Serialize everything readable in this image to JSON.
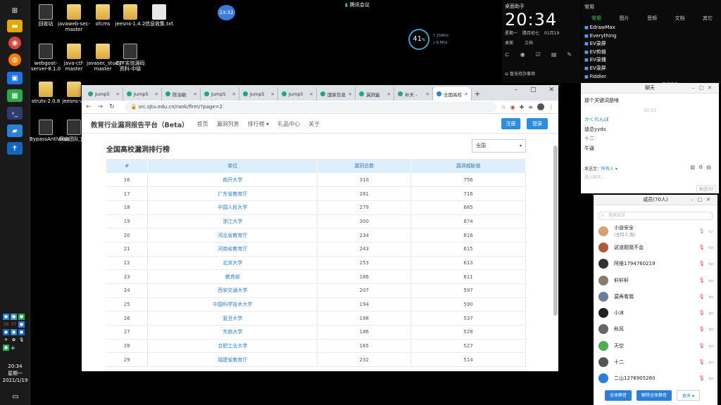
{
  "taskbar": {
    "tray_labels": [
      "39",
      "37"
    ],
    "time": "20:34",
    "weekday": "星期一",
    "date": "2021/1/19"
  },
  "desktop": {
    "icons": [
      {
        "label": "回收站",
        "kind": "app"
      },
      {
        "label": "javaweb-sec-master",
        "kind": "folder"
      },
      {
        "label": "ofcms",
        "kind": "folder"
      },
      {
        "label": "jeesns-1.4.2",
        "kind": "folder"
      },
      {
        "label": "信息收集.txt",
        "kind": "file"
      },
      {
        "label": "webgoat-server-8.1.0",
        "kind": "app"
      },
      {
        "label": "java-ctf-master",
        "kind": "folder"
      },
      {
        "label": "javasec_study-master",
        "kind": "folder"
      },
      {
        "label": "CTF实验源码资料-中级",
        "kind": "app"
      },
      {
        "label": "struts-2.0.8",
        "kind": "folder"
      },
      {
        "label": "jeesns-v1",
        "kind": "folder"
      },
      {
        "label": "BypassAntiVirus",
        "kind": "app"
      },
      {
        "label": "网安团队工具",
        "kind": "app"
      }
    ],
    "meeting_label": "腾讯会议",
    "blue_circle": "23:32",
    "speed_value": "41",
    "speed_unit": "%",
    "speed_up": "↑ 159K/s",
    "speed_down": "↓ 6.5K/s"
  },
  "clock_widget": {
    "title": "桌面助手",
    "time": "20:34",
    "weekday": "星期一",
    "lunar": "腊月初七",
    "date": "01月19",
    "row": [
      "桌面",
      "文档"
    ],
    "note": "暂无待办事项",
    "tools": [
      "⊏",
      "◉",
      "☑",
      "▤",
      "✎"
    ]
  },
  "launcher": {
    "title": "常用",
    "tabs": [
      "常用",
      "图片",
      "音频",
      "文档",
      "其它"
    ],
    "items": [
      "EdrawMax",
      "Everything",
      "EV录屏",
      "EV剪辑",
      "EV录播",
      "EV录屏",
      "Fiddler"
    ],
    "find_label": "查找文件"
  },
  "chat": {
    "title": "聊天",
    "messages": [
      {
        "type": "text",
        "text": "那个关键词是啥"
      },
      {
        "type": "time",
        "text": "20:33"
      },
      {
        "type": "nick",
        "text": "かくれんぼ"
      },
      {
        "type": "text",
        "text": "迪总yyds"
      },
      {
        "type": "nick",
        "text": "十二"
      },
      {
        "type": "text",
        "text": "牛逼"
      }
    ],
    "send_to_label": "发送至：",
    "send_to_value": "所有人 ▾",
    "placeholder": "输入聊天...",
    "send_button": "发送(S)"
  },
  "members": {
    "title": "成员(70人)",
    "search_placeholder": "搜索成员",
    "list": [
      {
        "name": "小迪安全",
        "sub": "(主持人,我)",
        "color": "#d9a070"
      },
      {
        "name": "这道题我不会",
        "sub": "",
        "color": "#b05a3a"
      },
      {
        "name": "阿维1794760219",
        "sub": "",
        "color": "#333"
      },
      {
        "name": "轩轩轩",
        "sub": "",
        "color": "#8a7b6a"
      },
      {
        "name": "莫再看我",
        "sub": "",
        "color": "#6a7fa0"
      },
      {
        "name": "小冰",
        "sub": "",
        "color": "#222"
      },
      {
        "name": "秋风",
        "sub": "",
        "color": "#666"
      },
      {
        "name": "天空",
        "sub": "",
        "color": "#4caf50"
      },
      {
        "name": "十二",
        "sub": "",
        "color": "#555"
      },
      {
        "name": "二山1276905280",
        "sub": "",
        "color": "#2b7fd8"
      }
    ],
    "footer": [
      "全体静音",
      "解除全体静音",
      "更多 ▾"
    ]
  },
  "browser": {
    "tabs": [
      "Jump5",
      "Jump5",
      "陈治敏",
      "Jump5",
      "Jump5",
      "Jump5",
      "国家信息",
      "漏洞盒",
      "补天 -",
      "全国高校"
    ],
    "url": "src.sjtu.edu.cn/rank/firm/?page=2",
    "site": {
      "brand": "教育行业漏洞报告平台（Beta）",
      "nav": [
        "首页",
        "漏洞列表",
        "排行榜 ▾",
        "礼品中心",
        "关于"
      ],
      "register": "注册",
      "login": "登录"
    },
    "page_title": "全国高校漏洞排行榜",
    "scope_select": "全国",
    "table": {
      "headers": [
        "#",
        "单位",
        "漏洞总数",
        "漏洞威胁值"
      ],
      "rows": [
        [
          "16",
          "南开大学",
          "310",
          "756"
        ],
        [
          "17",
          "广东省教育厅",
          "281",
          "716"
        ],
        [
          "18",
          "中国人民大学",
          "279",
          "685"
        ],
        [
          "19",
          "浙江大学",
          "300",
          "674"
        ],
        [
          "20",
          "河北省教育厅",
          "234",
          "616"
        ],
        [
          "21",
          "河南省教育厅",
          "243",
          "615"
        ],
        [
          "22",
          "北京大学",
          "253",
          "613"
        ],
        [
          "23",
          "教育部",
          "186",
          "611"
        ],
        [
          "24",
          "西安交通大学",
          "207",
          "597"
        ],
        [
          "25",
          "中国科学技术大学",
          "194",
          "590"
        ],
        [
          "26",
          "复旦大学",
          "198",
          "537"
        ],
        [
          "27",
          "东南大学",
          "186",
          "528"
        ],
        [
          "28",
          "合肥工业大学",
          "165",
          "527"
        ],
        [
          "29",
          "福建省教育厅",
          "232",
          "514"
        ]
      ]
    }
  }
}
